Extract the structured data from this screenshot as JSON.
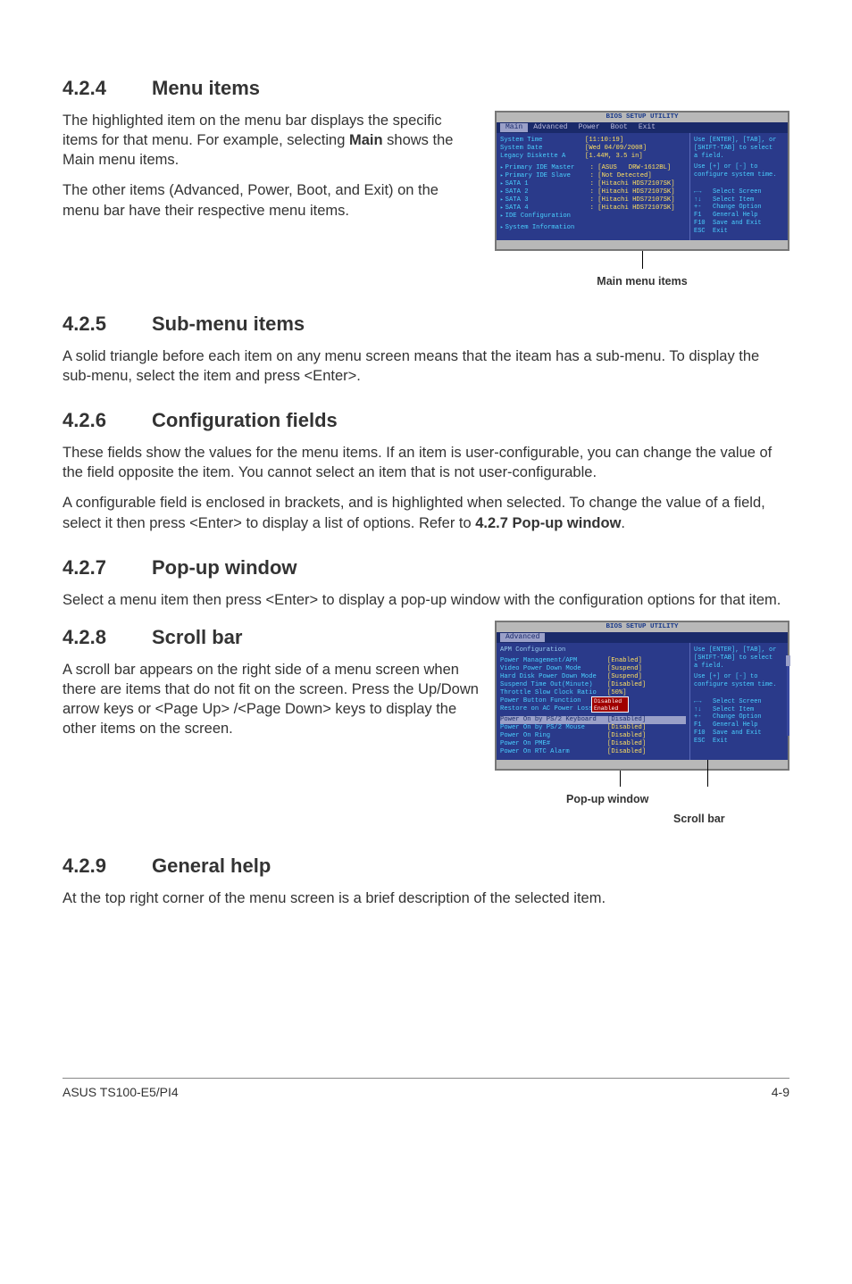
{
  "s424": {
    "num": "4.2.4",
    "title": "Menu items",
    "p1a": "The highlighted item on the menu bar displays the specific items for that menu. For example, selecting ",
    "p1b": "Main",
    "p1c": " shows the Main menu items.",
    "p2": "The other items (Advanced, Power, Boot, and Exit) on the menu bar have their respective menu items."
  },
  "bios1": {
    "title": "BIOS SETUP UTILITY",
    "tabs": [
      "Main",
      "Advanced",
      "Power",
      "Boot",
      "Exit"
    ],
    "selected_tab": "Main",
    "rows": [
      {
        "lbl": "System Time",
        "val": "[11:10:19]"
      },
      {
        "lbl": "System Date",
        "val": "[Wed 04/09/2008]"
      },
      {
        "lbl": "Legacy Diskette A",
        "val": "[1.44M, 3.5 in]"
      }
    ],
    "subrows": [
      {
        "lbl": "Primary IDE Master",
        "val": ": [ASUS   DRW-1612BL]"
      },
      {
        "lbl": "Primary IDE Slave",
        "val": ": [Not Detected]"
      },
      {
        "lbl": "SATA 1",
        "val": ": [Hitachi HDS72107SK]"
      },
      {
        "lbl": "SATA 2",
        "val": ": [Hitachi HDS72107SK]"
      },
      {
        "lbl": "SATA 3",
        "val": ": [Hitachi HDS72107SK]"
      },
      {
        "lbl": "SATA 4",
        "val": ": [Hitachi HDS72107SK]"
      },
      {
        "lbl": "IDE Configuration",
        "val": ""
      }
    ],
    "sysinfo": "System Information",
    "help1": "Use [ENTER], [TAB], or",
    "help2": "[SHIFT-TAB] to select",
    "help3": "a field.",
    "help4": "Use [+] or [-] to",
    "help5": "configure system time.",
    "nav": [
      "←→   Select Screen",
      "↑↓   Select Item",
      "+-   Change Option",
      "F1   General Help",
      "F10  Save and Exit",
      "ESC  Exit"
    ],
    "caption": "Main menu items"
  },
  "s425": {
    "num": "4.2.5",
    "title": "Sub-menu items",
    "p1": "A solid triangle before each item on any menu screen means that the iteam has a sub-menu. To display the sub-menu, select the item and press <Enter>."
  },
  "s426": {
    "num": "4.2.6",
    "title": "Configuration fields",
    "p1": "These fields show the values for the menu items. If an item is user-configurable, you can change the value of the field opposite the item. You cannot select an item that is not user-configurable.",
    "p2a": "A configurable field is enclosed in brackets, and is highlighted when selected. To change the value of a field, select it then press <Enter> to display a list of options. Refer to ",
    "p2b": "4.2.7 Pop-up window",
    "p2c": "."
  },
  "s427": {
    "num": "4.2.7",
    "title": "Pop-up window",
    "p1": "Select a menu item then press <Enter> to display a pop-up window with the configuration options for that item."
  },
  "s428": {
    "num": "4.2.8",
    "title": "Scroll bar",
    "p1": "A scroll bar appears on the right side of a menu screen when there are items that do not fit on the screen. Press the Up/Down arrow keys or <Page Up> /<Page Down> keys to display the other items on the screen."
  },
  "bios2": {
    "title": "BIOS SETUP UTILITY",
    "tab": "Advanced",
    "header": "APM Configuration",
    "rows": [
      {
        "lbl": "Power Management/APM",
        "val": "[Enabled]"
      },
      {
        "lbl": "Video Power Down Mode",
        "val": "[Suspend]"
      },
      {
        "lbl": "Hard Disk Power Down Mode",
        "val": "[Suspend]"
      },
      {
        "lbl": "Suspend Time Out(Minute)",
        "val": "[Disabled]"
      },
      {
        "lbl": "Throttle Slow Clock Ratio",
        "val": "[50%]"
      },
      {
        "lbl": "Power Button Function",
        "val": ""
      },
      {
        "lbl": "Restore on AC Power Loss",
        "val": ""
      }
    ],
    "hrow": {
      "lbl": "Power On by PS/2 Keyboard",
      "val": "[Disabled]"
    },
    "rows2": [
      {
        "lbl": "Power On by PS/2 Mouse",
        "val": "[Disabled]"
      },
      {
        "lbl": "Power On Ring",
        "val": "[Disabled]"
      },
      {
        "lbl": "Power On PME#",
        "val": "[Disabled]"
      },
      {
        "lbl": "Power On RTC Alarm",
        "val": "[Disabled]"
      }
    ],
    "popup": [
      "Disabled",
      "Enabled"
    ],
    "help1": "Use [ENTER], [TAB], or",
    "help2": "[SHIFT-TAB] to select",
    "help3": "a field.",
    "help4": "Use [+] or [-] to",
    "help5": "configure system time.",
    "nav": [
      "←→   Select Screen",
      "↑↓   Select Item",
      "+-   Change Option",
      "F1   General Help",
      "F10  Save and Exit",
      "ESC  Exit"
    ],
    "cap1": "Pop-up window",
    "cap2": "Scroll bar"
  },
  "s429": {
    "num": "4.2.9",
    "title": "General help",
    "p1": "At the top right corner of the menu screen is a brief description of the selected item."
  },
  "footer": {
    "left": "ASUS TS100-E5/PI4",
    "right": "4-9"
  }
}
